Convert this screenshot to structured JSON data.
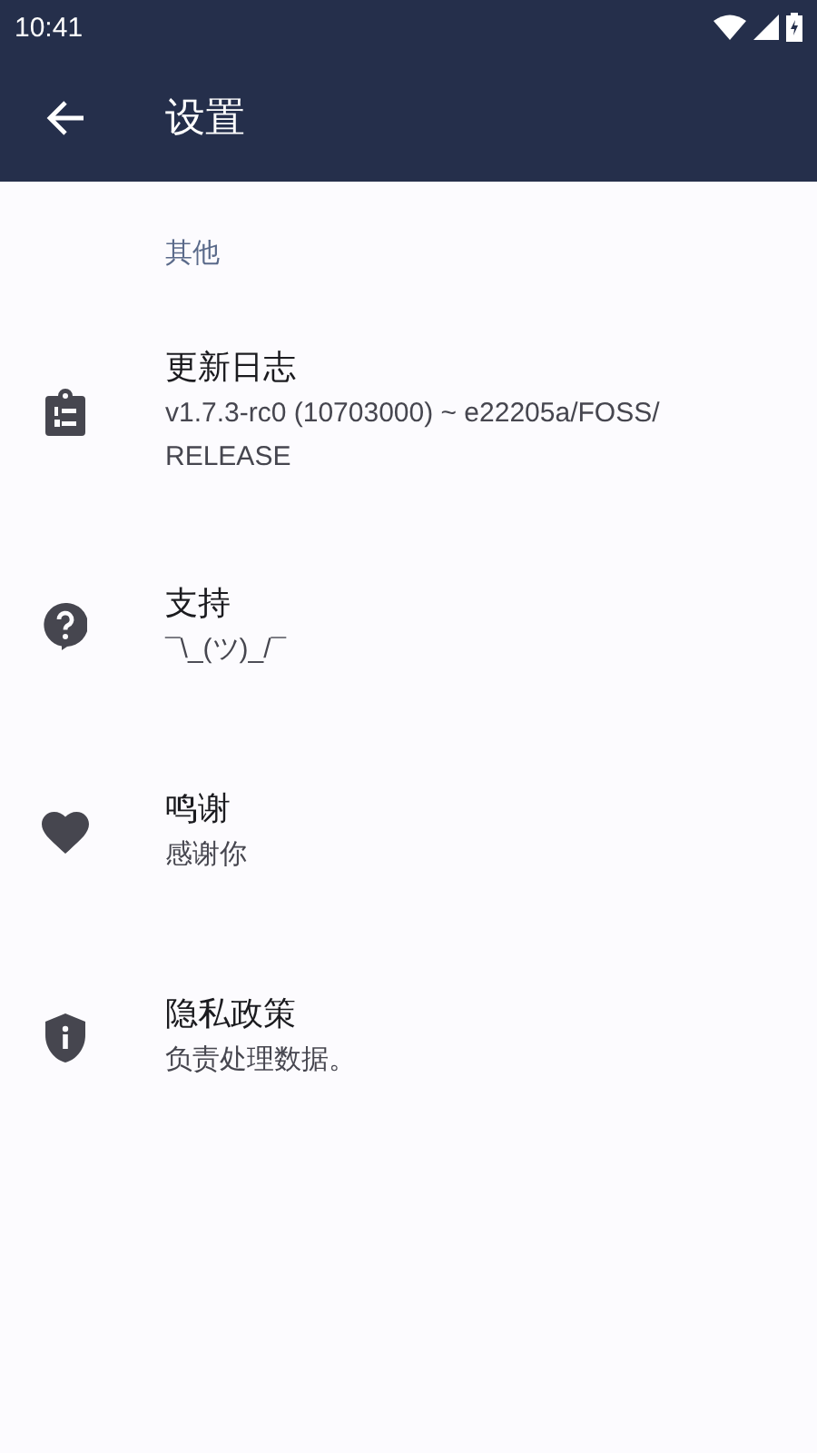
{
  "status_bar": {
    "time": "10:41"
  },
  "toolbar": {
    "title": "设置"
  },
  "section": {
    "header": "其他",
    "items": [
      {
        "kind": "changelog",
        "title": "更新日志",
        "summary": "v1.7.3-rc0 (10703000) ~ e22205a/FOSS/\nRELEASE"
      },
      {
        "kind": "help",
        "title": "支持",
        "summary": "¯\\_(ツ)_/¯"
      },
      {
        "kind": "heart",
        "title": "鸣谢",
        "summary": "感谢你"
      },
      {
        "kind": "shield",
        "title": "隐私政策",
        "summary": "负责处理数据。"
      }
    ]
  }
}
